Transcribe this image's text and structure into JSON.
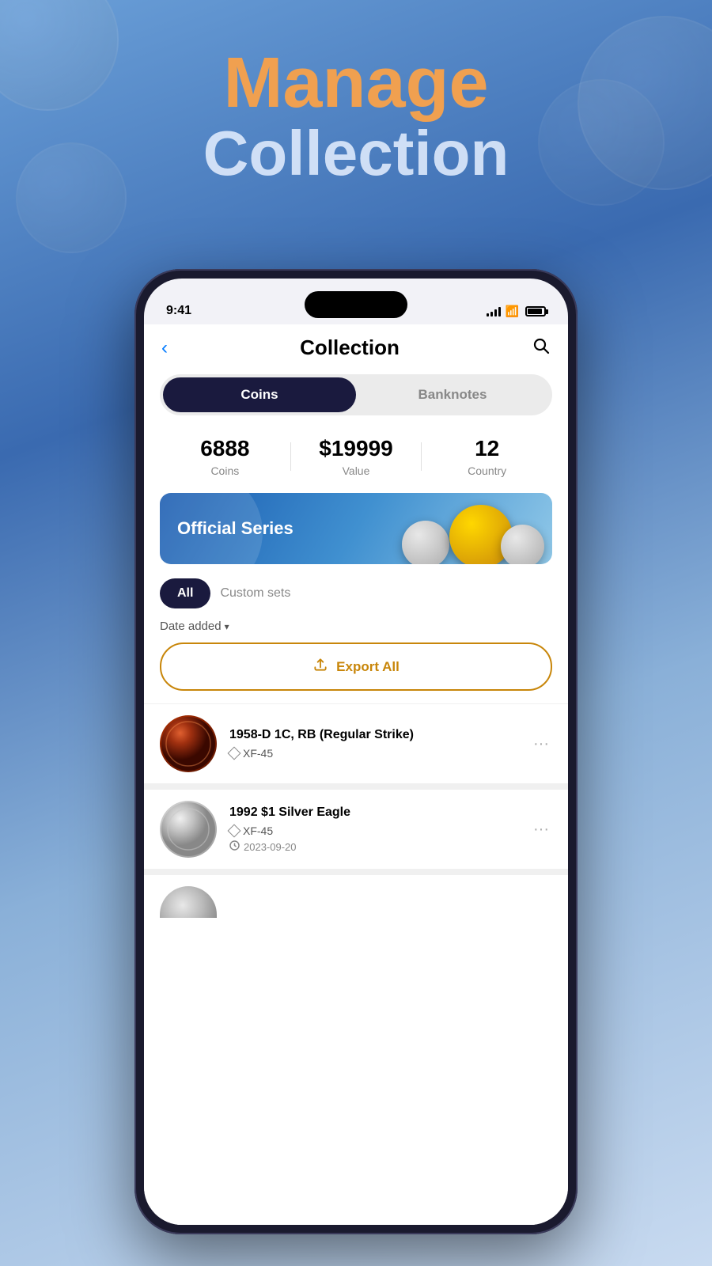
{
  "hero": {
    "manage_label": "Manage",
    "collection_label": "Collection"
  },
  "status_bar": {
    "time": "9:41",
    "signal_bars": [
      3,
      5,
      8,
      11,
      14
    ],
    "battery_percent": 80
  },
  "nav": {
    "back_label": "‹",
    "title": "Collection",
    "search_label": "🔍"
  },
  "segments": {
    "coins_label": "Coins",
    "banknotes_label": "Banknotes",
    "active": "coins"
  },
  "stats": {
    "coins_value": "6888",
    "coins_label": "Coins",
    "value_value": "$19999",
    "value_label": "Value",
    "country_value": "12",
    "country_label": "Country"
  },
  "banner": {
    "text": "Official Series"
  },
  "filters": {
    "all_label": "All",
    "custom_sets_label": "Custom sets"
  },
  "sort": {
    "label": "Date added",
    "chevron": "▾"
  },
  "export": {
    "label": "Export All",
    "icon": "⬆"
  },
  "coins": [
    {
      "name": "1958-D 1C, RB (Regular Strike)",
      "grade": "XF-45",
      "date": null,
      "style": "copper"
    },
    {
      "name": "1992 $1 Silver Eagle",
      "grade": "XF-45",
      "date": "2023-09-20",
      "style": "silver"
    }
  ],
  "colors": {
    "accent_orange": "#f0a050",
    "navy": "#1a1a3e",
    "gold": "#c8860a",
    "blue_gradient_start": "#6a9fd8",
    "blue_gradient_end": "#3a6ab0"
  }
}
